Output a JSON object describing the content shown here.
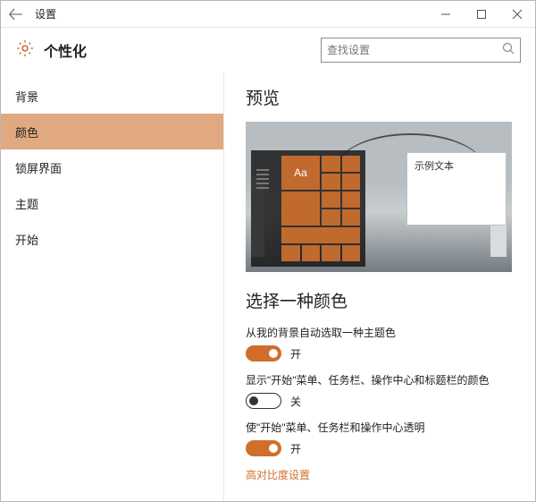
{
  "titlebar": {
    "title": "设置"
  },
  "header": {
    "title": "个性化"
  },
  "search": {
    "placeholder": "查找设置"
  },
  "sidebar": {
    "items": [
      {
        "label": "背景"
      },
      {
        "label": "颜色"
      },
      {
        "label": "锁屏界面"
      },
      {
        "label": "主题"
      },
      {
        "label": "开始"
      }
    ],
    "active_index": 1
  },
  "preview": {
    "title": "预览",
    "sample_window_text": "示例文本",
    "tile_glyph": "Aa"
  },
  "choose_color": {
    "title": "选择一种颜色",
    "options": [
      {
        "label": "从我的背景自动选取一种主题色",
        "on": true,
        "state_label": "开"
      },
      {
        "label": "显示\"开始\"菜单、任务栏、操作中心和标题栏的颜色",
        "on": false,
        "state_label": "关"
      },
      {
        "label": "使\"开始\"菜单、任务栏和操作中心透明",
        "on": true,
        "state_label": "开"
      }
    ],
    "high_contrast_link": "高对比度设置"
  },
  "colors": {
    "accent": "#cf6f2b"
  }
}
